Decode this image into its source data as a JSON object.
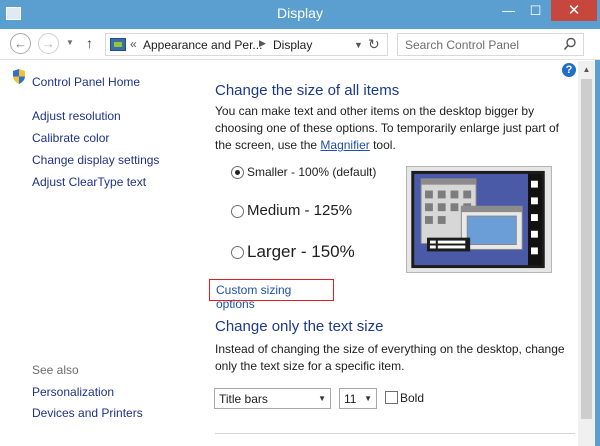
{
  "window": {
    "title": "Display",
    "minimize": "—",
    "maximize": "☐",
    "close": "✕"
  },
  "nav": {
    "back": "←",
    "forward": "→",
    "dropdown": "▼",
    "up": "↑",
    "crumb_sep1": "«",
    "crumb1": "Appearance and Per...",
    "crumb_sep2": "▶",
    "crumb2": "Display",
    "address_dropdown": "▼",
    "refresh": "↻",
    "search_placeholder": "Search Control Panel"
  },
  "sidebar": {
    "home": "Control Panel Home",
    "items": [
      "Adjust resolution",
      "Calibrate color",
      "Change display settings",
      "Adjust ClearType text"
    ],
    "see_also_label": "See also",
    "see_also": [
      "Personalization",
      "Devices and Printers"
    ]
  },
  "main": {
    "help": "?",
    "heading": "Change the size of all items",
    "para_before": "You can make text and other items on the desktop bigger by choosing one of these options. To temporarily enlarge just part of the screen, use the ",
    "para_link": "Magnifier",
    "para_after": " tool.",
    "options": [
      {
        "label": "Smaller - 100% (default)",
        "selected": true
      },
      {
        "label": "Medium - 125%",
        "selected": false
      },
      {
        "label": "Larger - 150%",
        "selected": false
      }
    ],
    "custom_link": "Custom sizing options",
    "heading2": "Change only the text size",
    "para2": "Instead of changing the size of everything on the desktop, change only the text size for a specific item.",
    "item_select": "Title bars",
    "size_select": "11",
    "select_arrow": "▼",
    "bold_label": "Bold",
    "bold_checked": false
  },
  "scrollbar": {
    "up": "▲"
  },
  "colors": {
    "titlebar": "#5a9fcf",
    "close": "#c7463d",
    "link": "#1e3287",
    "heading": "#1c3a8a",
    "highlight_box": "#e21e25"
  }
}
